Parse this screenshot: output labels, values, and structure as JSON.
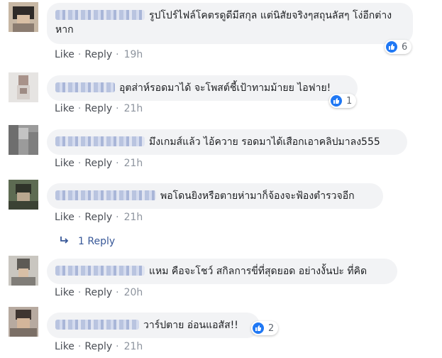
{
  "comments": [
    {
      "text": "รูปโปร์ไฟล์โคตรดูดีมีสกุล แต่นิสัยจริงๆสถุนลัสๆ โง่อีกต่างหาก",
      "like": "Like",
      "reply": "Reply",
      "time": "19h",
      "reactions": "6"
    },
    {
      "text": "อุตส่าห์รอดมาได้ จะโพสต์ชี้เป้าทามม้ายย ไอฟาย!",
      "like": "Like",
      "reply": "Reply",
      "time": "21h",
      "reactions": "1"
    },
    {
      "text": "มึงเกมส์แล้ว ไอ้ควาย รอดมาได้เสือกเอาคลิปมาลง555",
      "like": "Like",
      "reply": "Reply",
      "time": "21h"
    },
    {
      "text": "พอโดนยิงหรือตายห่ามาก็จ้องจะฟ้องตำรวจอีก",
      "like": "Like",
      "reply": "Reply",
      "time": "21h"
    },
    {
      "text": "แหม คือจะโชว์ สกิลการขี่ที่สุดยอด อย่างงั้นปะ ที่คิด",
      "like": "Like",
      "reply": "Reply",
      "time": "20h"
    },
    {
      "text": "วาร์ปตาย อ่อนแอสัส!!",
      "like": "Like",
      "reply": "Reply",
      "time": "21h",
      "reactions": "2"
    }
  ],
  "view_replies": {
    "label": "1 Reply"
  },
  "colors": {
    "bubble": "#f2f3f5",
    "link": "#385898",
    "like_blue": "#2078f4",
    "meta": "#8d949e"
  }
}
